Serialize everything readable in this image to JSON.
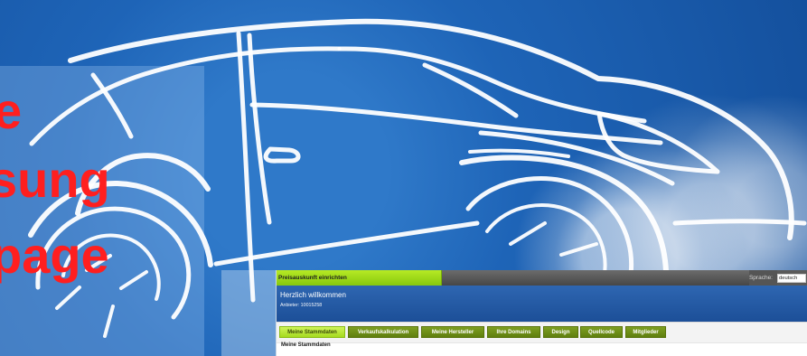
{
  "hero": {
    "lines": [
      "e",
      "sung",
      "page"
    ]
  },
  "app": {
    "topbar": {
      "title": "Preisauskunft einrichten",
      "language_label": "Sprache:",
      "language_value": "deutsch"
    },
    "welcome": {
      "title": "Herzlich willkommen",
      "subtitle": "Anbieter: 10015258"
    },
    "tabs": [
      {
        "label": "Meine Stammdaten",
        "active": true
      },
      {
        "label": "Verkaufskalkulation",
        "active": false
      },
      {
        "label": "Meine Hersteller",
        "active": false
      },
      {
        "label": "Ihre Domains",
        "active": false
      },
      {
        "label": "Design",
        "active": false
      },
      {
        "label": "Quellcode",
        "active": false
      },
      {
        "label": "Mitglieder",
        "active": false
      }
    ],
    "section_title": "Meine Stammdaten"
  }
}
